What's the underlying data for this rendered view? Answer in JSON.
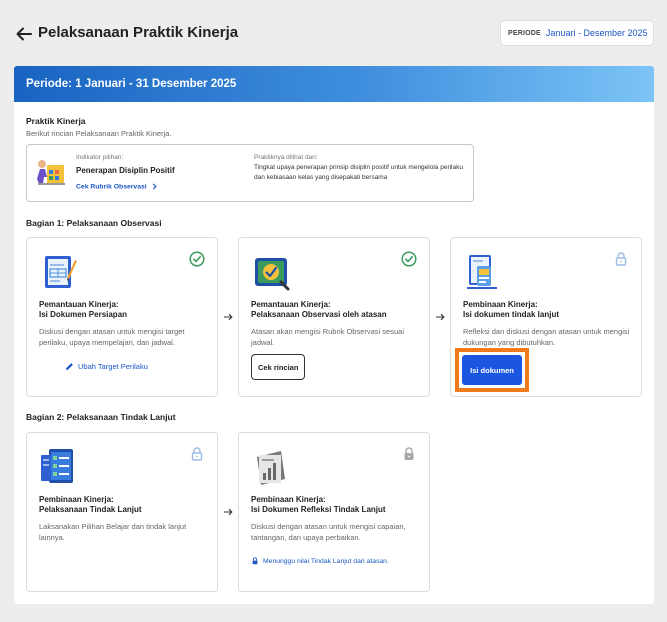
{
  "header": {
    "title": "Pelaksanaan Praktik Kinerja",
    "period_label": "PERIODE",
    "period_value": "Januari - Desember 2025"
  },
  "banner": {
    "text": "Periode: 1 Januari - 31 Desember 2025"
  },
  "practice": {
    "title": "Praktik Kinerja",
    "subtitle": "Berikut rincian Pelaksanaan Praktik Kinerja.",
    "indicator_label": "Indikator pilihan:",
    "indicator_value": "Penerapan Disiplin Positif",
    "rubric_link": "Cek Rubrik Observasi",
    "seen_label": "Praktiknya dilihat dari:",
    "seen_desc": "Tingkat upaya penerapan prinsip disiplin positif untuk mengelola perilaku dan kebiasaan kelas yang disepakati bersama"
  },
  "section1": {
    "title": "Bagian 1: Pelaksanaan Observasi",
    "cards": [
      {
        "title_line1": "Pemantauan Kinerja:",
        "title_line2": "Isi Dokumen Persiapan",
        "desc": "Diskusi dengan atasan untuk mengisi target perilaku, upaya mempelajari, dan jadwal.",
        "action": "Ubah Target Perilaku",
        "status": "check-circle-icon"
      },
      {
        "title_line1": "Pemantauan Kinerja:",
        "title_line2": "Pelaksanaan Observasi oleh atasan",
        "desc": "Atasan akan mengisi Rubrik Observasi sesuai jadwal.",
        "action": "Cek rincian",
        "status": "check-circle-icon"
      },
      {
        "title_line1": "Pembinaan Kinerja:",
        "title_line2": "Isi dokumen tindak lanjut",
        "desc": "Refleksi dan diskusi dengan atasan untuk mengisi dukungan yang dibutuhkan.",
        "action": "Isi dokumen",
        "status": "lock-icon"
      }
    ]
  },
  "section2": {
    "title": "Bagian 2: Pelaksanaan Tindak Lanjut",
    "cards": [
      {
        "title_line1": "Pembinaan Kinerja:",
        "title_line2": "Pelaksanaan Tindak Lanjut",
        "desc": "Laksanakan Pilihan Belajar dan tindak lanjut lainnya.",
        "status": "lock-icon"
      },
      {
        "title_line1": "Pembinaan Kinerja:",
        "title_line2": "Isi Dokumen Refleksi Tindak Lanjut",
        "desc": "Diskusi dengan atasan untuk mengisi capaian, tantangan, dan upaya perbaikan.",
        "waiting": "Menunggu nilai Tindak Lanjut dari atasan.",
        "status": "lock-icon"
      }
    ]
  },
  "colors": {
    "accent": "#1a56e0",
    "link": "#1a56c4",
    "success": "#3a9b5c",
    "highlight": "#f07b1c",
    "lock": "#9bbbe8",
    "lock_dim": "#a8a8a8"
  }
}
